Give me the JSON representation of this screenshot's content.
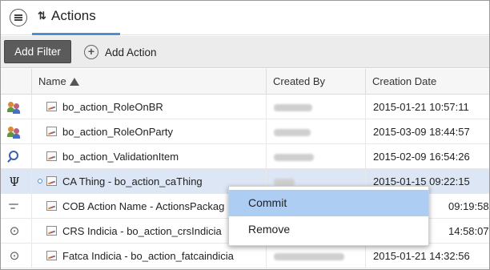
{
  "header": {
    "menu_icon": "hamburger-circle-icon",
    "tab_icon": "sync-arrows-icon",
    "tab_title": "Actions"
  },
  "toolbar": {
    "add_filter": "Add Filter",
    "add_action": "Add Action",
    "add_action_icon": "plus-circle-icon"
  },
  "columns": {
    "name": "Name",
    "created_by": "Created By",
    "creation_date": "Creation Date",
    "sort": "ascending"
  },
  "rows": [
    {
      "type_icon": "role-users-icon",
      "name": "bo_action_RoleOnBR",
      "created_by": "",
      "date": "2015-01-21 10:57:11"
    },
    {
      "type_icon": "role-users-icon",
      "name": "bo_action_RoleOnParty",
      "created_by": "",
      "date": "2015-03-09 18:44:57"
    },
    {
      "type_icon": "validation-magnifier-icon",
      "name": "bo_action_ValidationItem",
      "created_by": "",
      "date": "2015-02-09 16:54:26"
    },
    {
      "type_icon": "psi-icon",
      "name": "CA Thing - bo_action_caThing",
      "created_by": "",
      "date": "2015-01-15 09:22:15"
    },
    {
      "type_icon": "cob-lines-icon",
      "name": "COB Action Name - ActionsPackag",
      "created_by": "",
      "date": "09:19:58"
    },
    {
      "type_icon": "fingerprint-icon",
      "name": "CRS Indicia - bo_action_crsIndicia",
      "created_by": "",
      "date": "14:58:07"
    },
    {
      "type_icon": "fingerprint-icon",
      "name": "Fatca Indicia - bo_action_fatcaindicia",
      "created_by": "",
      "date": "2015-01-21 14:32:56"
    }
  ],
  "context_menu": {
    "items": [
      "Commit",
      "Remove"
    ]
  },
  "colors": {
    "accent": "#4a90d9",
    "selected_row": "#dce6f4",
    "menu_hover": "#aecdf2"
  }
}
